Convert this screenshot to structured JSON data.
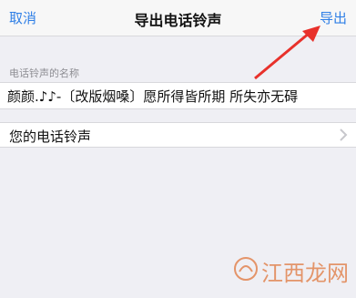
{
  "navbar": {
    "cancel_label": "取消",
    "title": "导出电话铃声",
    "export_label": "导出"
  },
  "form": {
    "name_section_label": "电话铃声的名称",
    "name_value": "颜颜.♪♪-〔改版烟嗓〕愿所得皆所期 所失亦无碍",
    "my_ringtones_label": "您的电话铃声"
  },
  "watermark": {
    "text": "江西龙网"
  },
  "colors": {
    "accent": "#2f7fe6",
    "annotation_arrow": "#e8312b",
    "background": "#efeff4"
  },
  "icons": {
    "chevron": "chevron-right-icon",
    "arrow": "annotation-arrow-icon"
  }
}
